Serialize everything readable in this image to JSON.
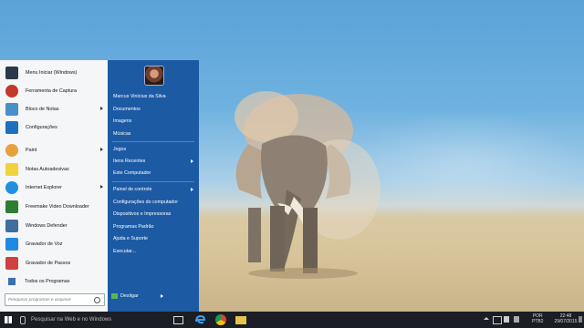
{
  "start_menu": {
    "left_items": [
      {
        "label": "Menu Iniciar (Windows)",
        "icon": "start-windows-icon",
        "color": "#2b3a4a",
        "arrow": false
      },
      {
        "label": "Ferramenta de Captura",
        "icon": "snipping-tool-icon",
        "color": "#c0392b",
        "arrow": false
      },
      {
        "label": "Bloco de Notas",
        "icon": "notepad-icon",
        "color": "#4a90c8",
        "arrow": true
      },
      {
        "label": "Configurações",
        "icon": "settings-gear-icon",
        "color": "#1e6fbf",
        "arrow": false
      },
      {
        "label": "Paint",
        "icon": "paint-icon",
        "color": "#e8a03a",
        "arrow": true
      },
      {
        "label": "Notas Autoadesivas",
        "icon": "sticky-notes-icon",
        "color": "#f2d23c",
        "arrow": false
      },
      {
        "label": "Internet Explorer",
        "icon": "internet-explorer-icon",
        "color": "#1f8fe0",
        "arrow": true
      },
      {
        "label": "Freemake Video Downloader",
        "icon": "freemake-icon",
        "color": "#2e7d32",
        "arrow": false
      },
      {
        "label": "Windows Defender",
        "icon": "windows-defender-icon",
        "color": "#3d6e9e",
        "arrow": false
      },
      {
        "label": "Gravador de Voz",
        "icon": "voice-recorder-icon",
        "color": "#1e88e5",
        "arrow": false
      },
      {
        "label": "Gravador de Passos",
        "icon": "steps-recorder-icon",
        "color": "#d04040",
        "arrow": false
      }
    ],
    "all_programs": "Todos os Programas",
    "search_placeholder": "Pesquisar programas e arquivos",
    "right_items_group1": [
      "Marcus Vinícius da Silva",
      "Documentos",
      "Imagens",
      "Músicas"
    ],
    "right_items_group2": [
      {
        "label": "Jogos",
        "arrow": false
      },
      {
        "label": "Itens Recentes",
        "arrow": true
      },
      {
        "label": "Este Computador",
        "arrow": false
      }
    ],
    "right_items_group3": [
      {
        "label": "Painel de controle",
        "arrow": true
      },
      {
        "label": "Configurações do computador",
        "arrow": false
      },
      {
        "label": "Dispositivos e Impressoras",
        "arrow": false
      },
      {
        "label": "Programas Padrão",
        "arrow": false
      },
      {
        "label": "Ajuda e Suporte",
        "arrow": false
      },
      {
        "label": "Executar...",
        "arrow": false
      }
    ],
    "shutdown_label": "Desligar"
  },
  "taskbar": {
    "search_text": "Pesquisar na Web e no Windows",
    "language": "POR",
    "keyboard": "PTB2",
    "time": "22:48",
    "date": "29/07/2015"
  },
  "colors": {
    "menu_blue": "#1c5aa4",
    "taskbar": "#1b1e24"
  }
}
